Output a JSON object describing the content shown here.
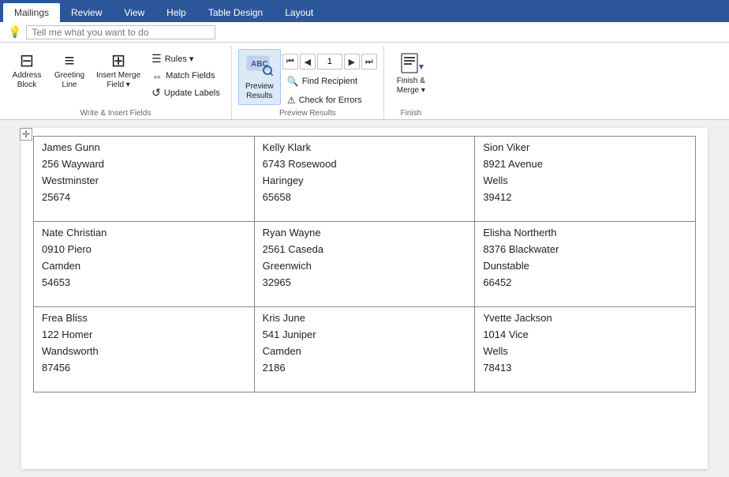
{
  "tabs": [
    {
      "id": "mailings",
      "label": "Mailings",
      "active": true
    },
    {
      "id": "review",
      "label": "Review",
      "active": false
    },
    {
      "id": "view",
      "label": "View",
      "active": false
    },
    {
      "id": "help",
      "label": "Help",
      "active": false
    },
    {
      "id": "table-design",
      "label": "Table Design",
      "active": false
    },
    {
      "id": "layout",
      "label": "Layout",
      "active": false
    }
  ],
  "helpbar": {
    "placeholder": "Tell me what you want to do"
  },
  "ribbon": {
    "groups": [
      {
        "id": "write-insert",
        "label": "Write & Insert Fields",
        "buttons": [
          {
            "id": "address-block",
            "label": "Address\nBlock",
            "icon": "⊟"
          },
          {
            "id": "greeting-line",
            "label": "Greeting\nLine",
            "icon": "≡"
          },
          {
            "id": "insert-merge-field",
            "label": "Insert Merge\nField",
            "icon": "⊞"
          }
        ],
        "smallButtons": [
          {
            "id": "rules",
            "label": "Rules",
            "icon": "☰",
            "dropdown": true
          },
          {
            "id": "match-fields",
            "label": "Match Fields",
            "icon": "⇔"
          },
          {
            "id": "update-labels",
            "label": "Update Labels",
            "icon": "↺"
          }
        ]
      },
      {
        "id": "preview-results",
        "label": "Preview Results",
        "navInput": "1",
        "buttons": [
          {
            "id": "preview-results-btn",
            "label": "Preview\nResults",
            "icon": "🔍",
            "active": true
          }
        ],
        "navButtons": [
          {
            "id": "nav-first",
            "label": "⏮"
          },
          {
            "id": "nav-prev",
            "label": "◀"
          },
          {
            "id": "nav-next",
            "label": "▶"
          },
          {
            "id": "nav-last",
            "label": "⏭"
          }
        ],
        "smallButtons": [
          {
            "id": "find-recipient",
            "label": "Find Recipient",
            "icon": "🔍"
          },
          {
            "id": "check-errors",
            "label": "Check for Errors",
            "icon": "⚠"
          }
        ]
      },
      {
        "id": "finish",
        "label": "Finish",
        "buttons": [
          {
            "id": "finish-merge",
            "label": "Finish &\nMerge",
            "icon": "📄",
            "dropdown": true
          }
        ]
      }
    ]
  },
  "table": {
    "rows": [
      [
        {
          "name": "James Gunn",
          "address": "256 Wayward",
          "city": "Westminster",
          "zip": "25674"
        },
        {
          "name": "Kelly Klark",
          "address": "6743 Rosewood",
          "city": "Haringey",
          "zip": "65658"
        },
        {
          "name": "Sion Viker",
          "address": "8921 Avenue",
          "city": "Wells",
          "zip": "39412"
        }
      ],
      [
        {
          "name": "Nate Christian",
          "address": "0910 Piero",
          "city": "Camden",
          "zip": "54653"
        },
        {
          "name": "Ryan Wayne",
          "address": "2561 Caseda",
          "city": "Greenwich",
          "zip": "32965"
        },
        {
          "name": "Elisha Northerth",
          "address": "8376 Blackwater",
          "city": "Dunstable",
          "zip": "66452"
        }
      ],
      [
        {
          "name": "Frea Bliss",
          "address": "122 Homer",
          "city": "Wandsworth",
          "zip": "87456"
        },
        {
          "name": "Kris June",
          "address": "541 Juniper",
          "city": "Camden",
          "zip": "2186"
        },
        {
          "name": "Yvette Jackson",
          "address": "1014 Vice",
          "city": "Wells",
          "zip": "78413"
        }
      ]
    ]
  }
}
